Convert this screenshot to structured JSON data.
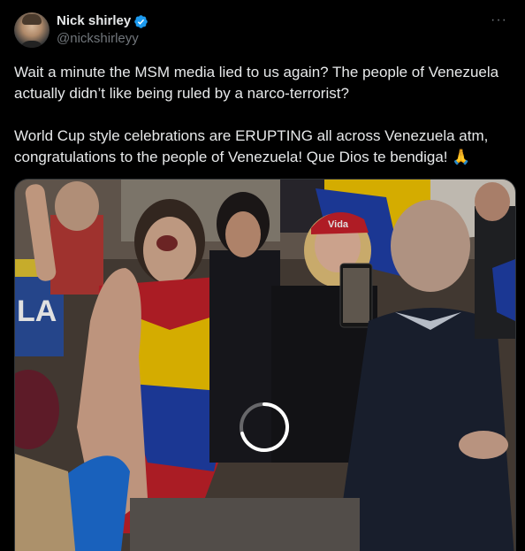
{
  "author": {
    "display_name": "Nick shirley",
    "handle": "@nickshirleyy",
    "verified": true
  },
  "more_icon": "more-horizontal-icon",
  "tweet_text": {
    "paragraph1": "Wait a minute the MSM media lied to us again? The people of Venezuela actually didn’t like being ruled by a narco-terrorist?",
    "paragraph2": "World Cup style celebrations are ERUPTING all across Venezuela atm, congratulations to the people of Venezuela! Que Dios te bendiga!",
    "emoji": "🙏"
  },
  "media": {
    "type": "video",
    "state": "loading",
    "sign_text": "LA",
    "cap_text": "Vida"
  },
  "colors": {
    "background": "#000000",
    "text": "#e7e9ea",
    "secondary_text": "#71767b",
    "verified_blue": "#1d9bf0",
    "venezuela_yellow": "#f2c400",
    "venezuela_blue": "#1f3fa8",
    "venezuela_red": "#cc2229"
  }
}
